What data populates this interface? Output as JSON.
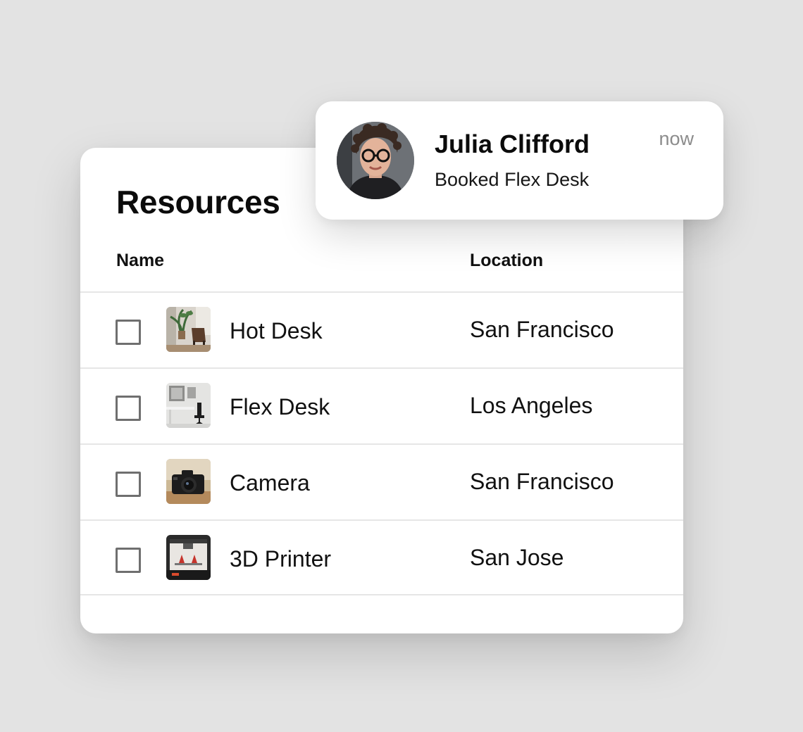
{
  "resources_card": {
    "title": "Resources",
    "columns": {
      "name": "Name",
      "location": "Location"
    },
    "rows": [
      {
        "name": "Hot Desk",
        "location": "San Francisco",
        "thumbnail_icon": "hot-desk-photo",
        "checked": false
      },
      {
        "name": "Flex Desk",
        "location": "Los Angeles",
        "thumbnail_icon": "flex-desk-photo",
        "checked": false
      },
      {
        "name": "Camera",
        "location": "San Francisco",
        "thumbnail_icon": "camera-photo",
        "checked": false
      },
      {
        "name": "3D Printer",
        "location": "San Jose",
        "thumbnail_icon": "3d-printer-photo",
        "checked": false
      }
    ]
  },
  "notification": {
    "name": "Julia Clifford",
    "message": "Booked Flex Desk",
    "time": "now",
    "avatar_icon": "user-avatar-photo"
  },
  "colors": {
    "background": "#e3e3e3",
    "card": "#ffffff",
    "divider": "#e6e6e6",
    "checkbox_border": "#6f6f6f",
    "muted_text": "#8c8c8c"
  }
}
